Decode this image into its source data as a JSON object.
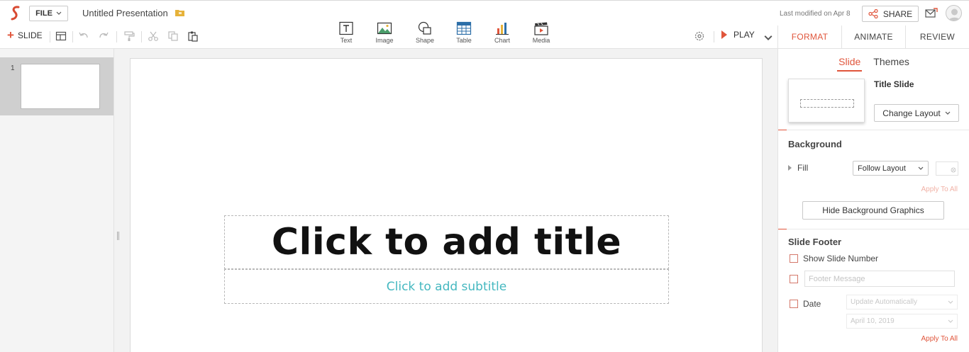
{
  "app": {
    "file_label": "FILE",
    "doc_title": "Untitled Presentation",
    "last_modified": "Last modified on Apr 8",
    "share_label": "SHARE"
  },
  "toolbar": {
    "add_slide_label": "SLIDE",
    "insert": [
      {
        "label": "Text",
        "icon": "text-icon"
      },
      {
        "label": "Image",
        "icon": "image-icon"
      },
      {
        "label": "Shape",
        "icon": "shape-icon"
      },
      {
        "label": "Table",
        "icon": "table-icon"
      },
      {
        "label": "Chart",
        "icon": "chart-icon"
      },
      {
        "label": "Media",
        "icon": "media-icon"
      }
    ],
    "play_label": "PLAY"
  },
  "right_tabs": [
    "FORMAT",
    "ANIMATE",
    "REVIEW"
  ],
  "thumbnails": [
    {
      "number": "1"
    }
  ],
  "slide": {
    "title_placeholder": "Click to add title",
    "subtitle_placeholder": "Click to add subtitle"
  },
  "format_panel": {
    "subtabs": [
      "Slide",
      "Themes"
    ],
    "layout_name": "Title Slide",
    "change_layout_label": "Change Layout",
    "background_title": "Background",
    "fill_label": "Fill",
    "fill_value": "Follow Layout",
    "apply_to_all": "Apply To All",
    "hide_bg_graphics": "Hide Background Graphics",
    "footer_title": "Slide Footer",
    "show_slide_number": "Show Slide Number",
    "footer_message_placeholder": "Footer Message",
    "date_label": "Date",
    "date_mode": "Update Automatically",
    "date_value": "April 10, 2019",
    "apply_to_all_2": "Apply To All"
  },
  "colors": {
    "accent": "#e0553b",
    "subtitle": "#45b8c0"
  }
}
